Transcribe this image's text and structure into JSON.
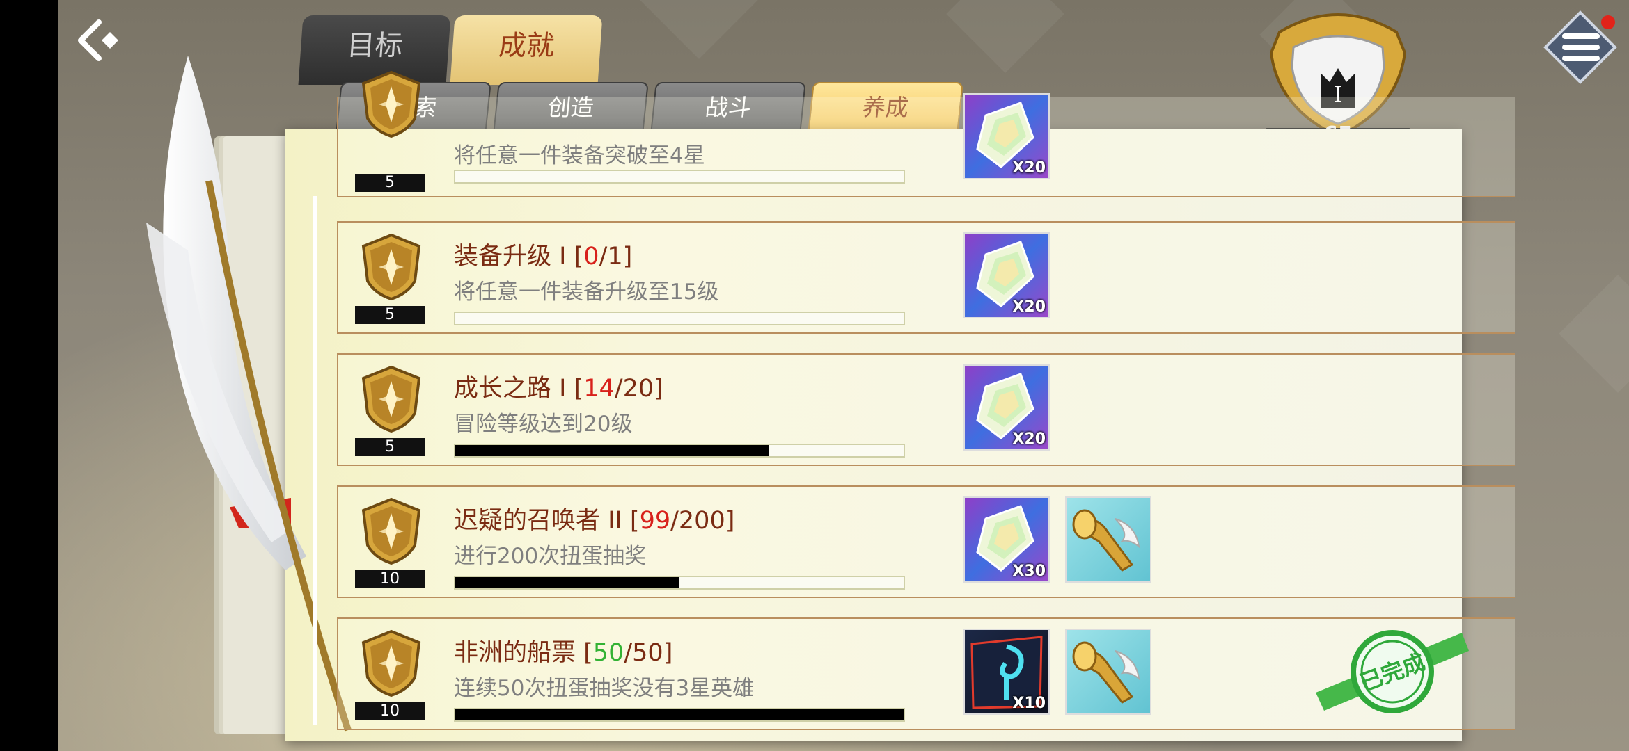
{
  "tabs": {
    "main": [
      {
        "label": "目标",
        "active": false
      },
      {
        "label": "成就",
        "active": true
      }
    ],
    "sub": [
      {
        "label": "探索",
        "active": false
      },
      {
        "label": "创造",
        "active": false
      },
      {
        "label": "战斗",
        "active": false
      },
      {
        "label": "养成",
        "active": true
      }
    ]
  },
  "rank": {
    "tier": "I",
    "level": "65"
  },
  "rows": [
    {
      "title_prefix": "",
      "count": "",
      "total": "",
      "desc": "将任意一件装备突破至4星",
      "points": "5",
      "progress": 0,
      "rewards": [
        {
          "icon": "rainbow-crystal-icon",
          "qty": "X20"
        }
      ]
    },
    {
      "title_prefix": "装备升级 I ",
      "count": "0",
      "total": "1",
      "count_color": "red",
      "desc": "将任意一件装备升级至15级",
      "points": "5",
      "progress": 0,
      "rewards": [
        {
          "icon": "rainbow-crystal-icon",
          "qty": "X20"
        }
      ]
    },
    {
      "title_prefix": "成长之路 I ",
      "count": "14",
      "total": "20",
      "count_color": "red",
      "desc": "冒险等级达到20级",
      "points": "5",
      "progress": 0.7,
      "rewards": [
        {
          "icon": "rainbow-crystal-icon",
          "qty": "X20"
        }
      ]
    },
    {
      "title_prefix": "迟疑的召唤者 II ",
      "count": "99",
      "total": "200",
      "count_color": "red",
      "desc": "进行200次扭蛋抽奖",
      "points": "10",
      "progress": 0.495,
      "rewards": [
        {
          "icon": "rainbow-crystal-icon",
          "qty": "X30"
        },
        {
          "icon": "golden-horn-icon",
          "qty": ""
        }
      ]
    },
    {
      "title_prefix": "非洲的船票 ",
      "count": "50",
      "total": "50",
      "count_color": "green",
      "desc": "连续50次扭蛋抽奖没有3星英雄",
      "points": "10",
      "progress": 1.0,
      "rewards": [
        {
          "icon": "summon-ticket-icon",
          "qty": "X10"
        },
        {
          "icon": "golden-horn-icon",
          "qty": ""
        }
      ],
      "status": "已完成"
    }
  ],
  "colors": {
    "accent": "#f3c65d",
    "title": "#7a2b12",
    "count_red": "#d8211b",
    "count_green": "#33b234",
    "stamp_green": "#2fa83a"
  }
}
